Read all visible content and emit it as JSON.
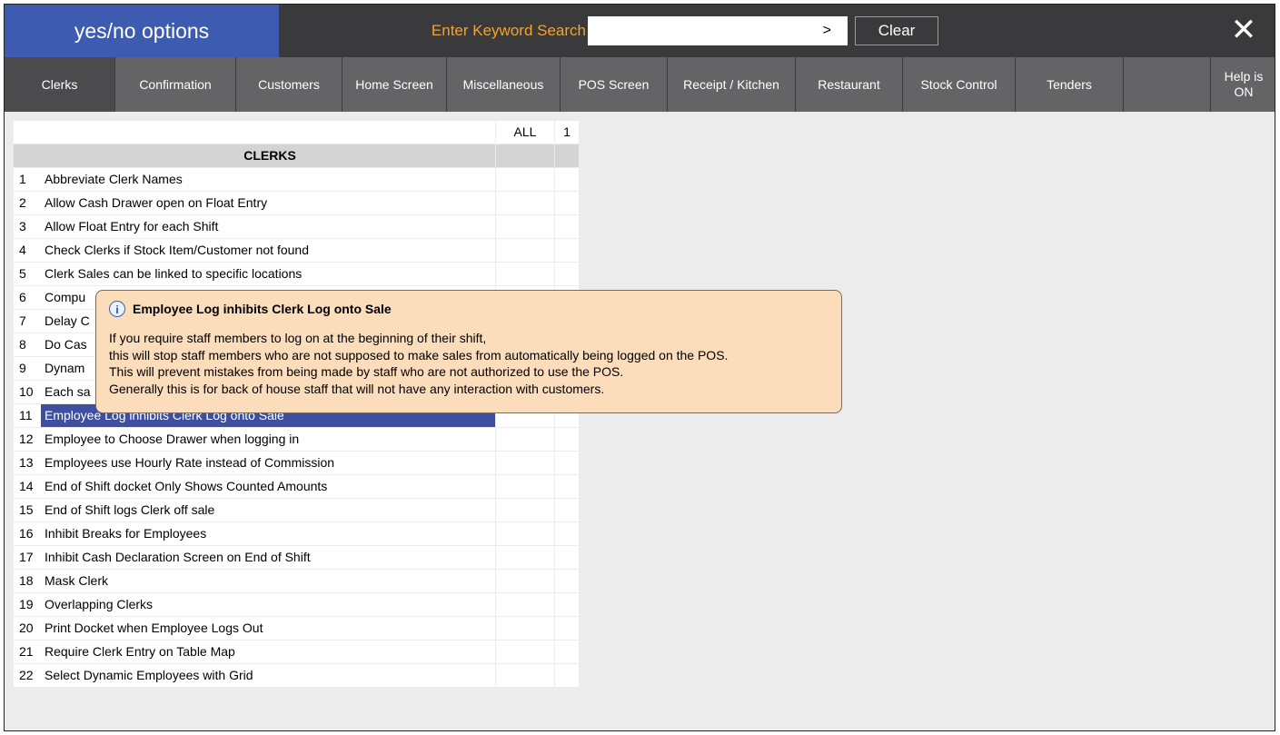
{
  "header": {
    "title": "yes/no options",
    "search_label": "Enter Keyword Search",
    "search_value": "",
    "go_label": ">",
    "clear_label": "Clear",
    "close_label": "✕"
  },
  "tabs": [
    {
      "label": "Clerks",
      "active": true
    },
    {
      "label": "Confirmation"
    },
    {
      "label": "Customers"
    },
    {
      "label": "Home Screen"
    },
    {
      "label": "Miscellaneous"
    },
    {
      "label": "POS Screen"
    },
    {
      "label": "Receipt / Kitchen"
    },
    {
      "label": "Restaurant"
    },
    {
      "label": "Stock Control"
    },
    {
      "label": "Tenders"
    },
    {
      "label": ""
    }
  ],
  "help": {
    "line1": "Help is",
    "line2": "ON"
  },
  "grid": {
    "col_all": "ALL",
    "col_one": "1",
    "section": "CLERKS",
    "rows": [
      {
        "num": "1",
        "name": "Abbreviate Clerk Names"
      },
      {
        "num": "2",
        "name": "Allow Cash Drawer open on Float Entry"
      },
      {
        "num": "3",
        "name": "Allow Float Entry for each Shift"
      },
      {
        "num": "4",
        "name": "Check Clerks if Stock Item/Customer not found"
      },
      {
        "num": "5",
        "name": "Clerk Sales can be linked to specific locations"
      },
      {
        "num": "6",
        "name": "Compu"
      },
      {
        "num": "7",
        "name": "Delay C"
      },
      {
        "num": "8",
        "name": "Do Cas"
      },
      {
        "num": "9",
        "name": "Dynam"
      },
      {
        "num": "10",
        "name": "Each sa"
      },
      {
        "num": "11",
        "name": "Employee Log inhibits Clerk Log onto Sale",
        "selected": true
      },
      {
        "num": "12",
        "name": "Employee to Choose Drawer when logging in"
      },
      {
        "num": "13",
        "name": "Employees use Hourly Rate instead of Commission"
      },
      {
        "num": "14",
        "name": "End of Shift docket Only Shows Counted Amounts"
      },
      {
        "num": "15",
        "name": "End of Shift logs Clerk off sale"
      },
      {
        "num": "16",
        "name": "Inhibit Breaks for Employees"
      },
      {
        "num": "17",
        "name": "Inhibit Cash Declaration Screen on End of Shift"
      },
      {
        "num": "18",
        "name": "Mask Clerk"
      },
      {
        "num": "19",
        "name": "Overlapping Clerks"
      },
      {
        "num": "20",
        "name": "Print Docket when Employee Logs Out"
      },
      {
        "num": "21",
        "name": "Require Clerk Entry on Table Map"
      },
      {
        "num": "22",
        "name": "Select Dynamic Employees with Grid"
      }
    ]
  },
  "tooltip": {
    "icon": "info-icon",
    "title": "Employee Log inhibits Clerk Log onto Sale",
    "lines": [
      "If you require staff members to log on at the beginning of their shift,",
      "this will stop staff members who are not supposed to make sales from automatically being logged on the POS.",
      "This will prevent mistakes from being made by staff who are not authorized to use the POS.",
      "Generally this is for back of house staff that will not have any interaction with customers."
    ]
  },
  "colors": {
    "title_bg": "#3d5bb0",
    "search_label": "#f3a32c",
    "selected_row": "#3d4f9e",
    "tooltip_bg": "#fbdcbb"
  }
}
